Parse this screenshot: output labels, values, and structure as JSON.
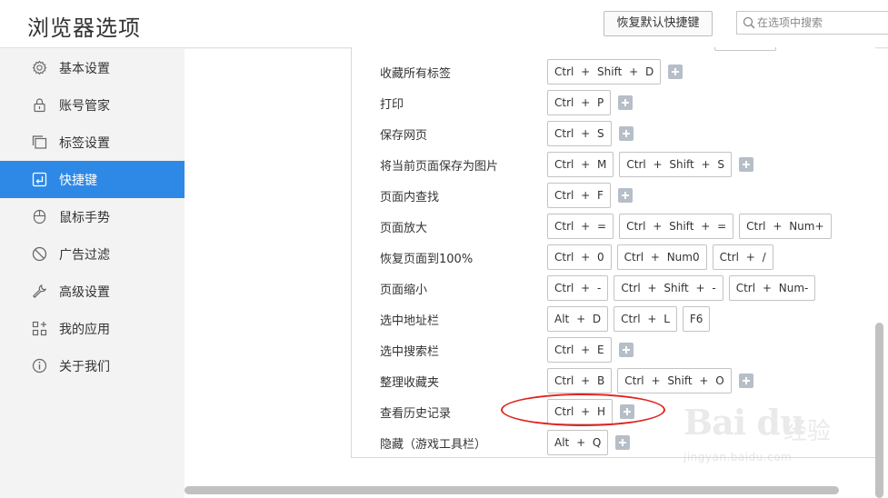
{
  "header": {
    "title": "浏览器选项",
    "restore_button": "恢复默认快捷键",
    "search_placeholder": "在选项中搜索"
  },
  "sidebar": {
    "items": [
      {
        "label": "基本设置",
        "icon": "gear-icon",
        "active": false
      },
      {
        "label": "账号管家",
        "icon": "lock-icon",
        "active": false
      },
      {
        "label": "标签设置",
        "icon": "tabs-icon",
        "active": false
      },
      {
        "label": "快捷键",
        "icon": "shortcut-icon",
        "active": true
      },
      {
        "label": "鼠标手势",
        "icon": "mouse-icon",
        "active": false
      },
      {
        "label": "广告过滤",
        "icon": "block-icon",
        "active": false
      },
      {
        "label": "高级设置",
        "icon": "wrench-icon",
        "active": false
      },
      {
        "label": "我的应用",
        "icon": "apps-icon",
        "active": false
      },
      {
        "label": "关于我们",
        "icon": "info-icon",
        "active": false
      }
    ]
  },
  "shortcuts": [
    {
      "label": "收藏所有标签",
      "keys": [
        "Ctrl + Shift + D"
      ],
      "addable": true
    },
    {
      "label": "打印",
      "keys": [
        "Ctrl + P"
      ],
      "addable": true
    },
    {
      "label": "保存网页",
      "keys": [
        "Ctrl + S"
      ],
      "addable": true
    },
    {
      "label": "将当前页面保存为图片",
      "keys": [
        "Ctrl + M",
        "Ctrl + Shift + S"
      ],
      "addable": true
    },
    {
      "label": "页面内查找",
      "keys": [
        "Ctrl + F"
      ],
      "addable": true
    },
    {
      "label": "页面放大",
      "keys": [
        "Ctrl + =",
        "Ctrl + Shift + =",
        "Ctrl + Num+"
      ],
      "addable": false
    },
    {
      "label": "恢复页面到100%",
      "keys": [
        "Ctrl + 0",
        "Ctrl + Num0",
        "Ctrl + /"
      ],
      "addable": false
    },
    {
      "label": "页面缩小",
      "keys": [
        "Ctrl + -",
        "Ctrl + Shift + -",
        "Ctrl + Num-"
      ],
      "addable": false
    },
    {
      "label": "选中地址栏",
      "keys": [
        "Alt + D",
        "Ctrl + L",
        "F6"
      ],
      "addable": false
    },
    {
      "label": "选中搜索栏",
      "keys": [
        "Ctrl + E"
      ],
      "addable": true
    },
    {
      "label": "整理收藏夹",
      "keys": [
        "Ctrl + B",
        "Ctrl + Shift + O"
      ],
      "addable": true
    },
    {
      "label": "查看历史记录",
      "keys": [
        "Ctrl + H"
      ],
      "addable": true
    },
    {
      "label": "隐藏（游戏工具栏）",
      "keys": [
        "Alt + Q"
      ],
      "addable": true
    }
  ],
  "watermark": {
    "logo": "Bai du",
    "text": "经验",
    "url": "jingyan.baidu.com"
  },
  "colors": {
    "accent": "#2e89e6",
    "highlight_circle": "#e0231e"
  }
}
